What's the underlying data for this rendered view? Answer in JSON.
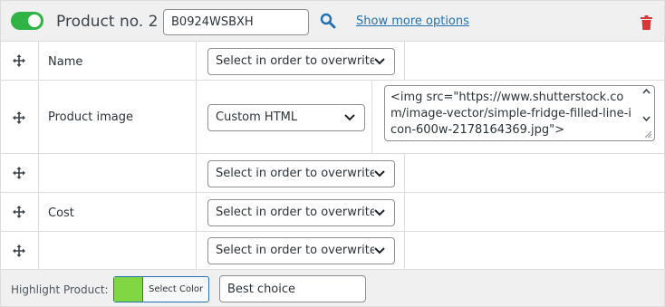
{
  "header": {
    "toggle_on": true,
    "title": "Product no. 2",
    "sku_value": "B0924WSBXH",
    "more_options": "Show more options"
  },
  "rows": [
    {
      "label": "Name",
      "select": "Select in order to overwrite..."
    },
    {
      "label": "Product image",
      "select": "Custom HTML",
      "custom_html": "<img src=\"https://www.shutterstock.com/image-vector/simple-fridge-filled-line-icon-600w-2178164369.jpg\">"
    },
    {
      "label": "",
      "select": "Select in order to overwrite..."
    },
    {
      "label": "Cost",
      "select": "Select in order to overwrite..."
    },
    {
      "label": "",
      "select": "Select in order to overwrite..."
    }
  ],
  "footer": {
    "highlight_label": "Highlight Product:",
    "color_button": "Select Color",
    "color_value": "#81d742",
    "badge_text": "Best choice"
  },
  "colors": {
    "toggle": "#2fb344",
    "link": "#2271b1",
    "trash": "#d63638",
    "search": "#2271b1"
  },
  "icons": [
    "toggle",
    "search-icon",
    "trash-icon",
    "move-icon",
    "chevron-down-icon"
  ]
}
